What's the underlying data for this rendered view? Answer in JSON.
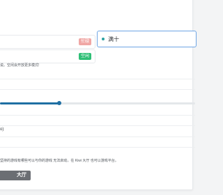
{
  "slots": [
    {
      "status": "忙碌",
      "status_color": "#f0a7a5"
    },
    {
      "status": "空闲",
      "status_color": "#2fbf76"
    }
  ],
  "selected_card": {
    "label": "满十"
  },
  "hint_text": "说。空闲会开放更多模式!",
  "slider": {
    "progress": 0.305,
    "color": "#1f6fa3"
  },
  "value_text": "o)",
  "note_text": "坚持的游戏有哪些可以与你的游戏 无法启动，在 Kiwi 大厅 也可以游戏平台。",
  "action_button": {
    "label": "大厅"
  }
}
